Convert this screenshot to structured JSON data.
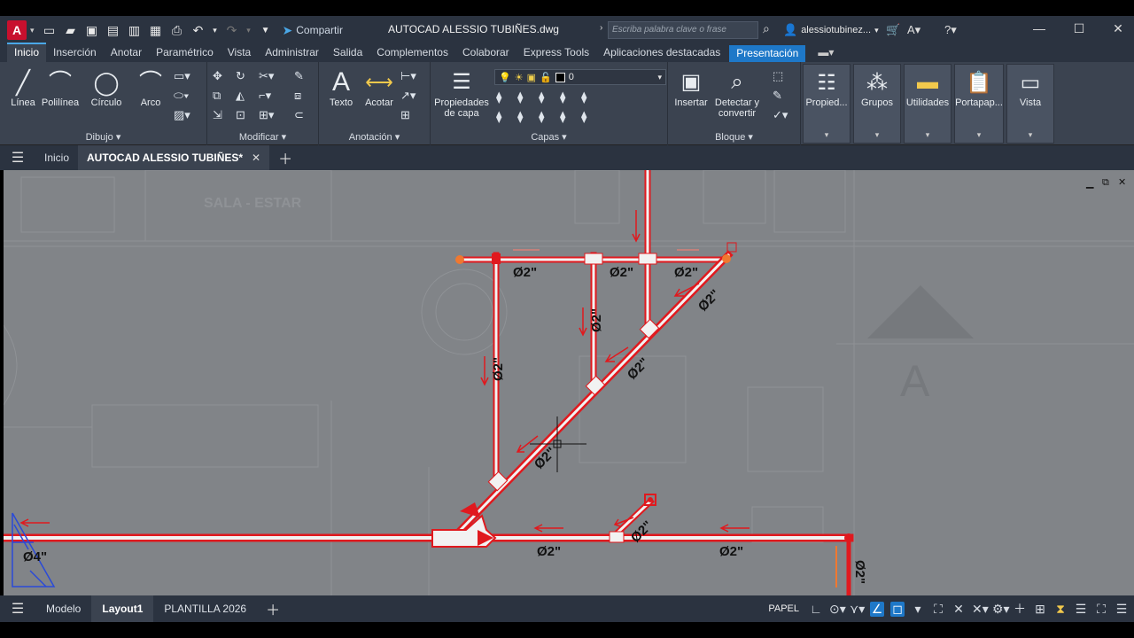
{
  "app": {
    "logo_letter": "A",
    "document_title": "AUTOCAD ALESSIO TUBIÑES.dwg",
    "share_label": "Compartir",
    "search_placeholder": "Escriba palabra clave o frase",
    "user_name": "alessiotubinez..."
  },
  "ribbon_tabs": [
    {
      "label": "Inicio",
      "active": true
    },
    {
      "label": "Inserción"
    },
    {
      "label": "Anotar"
    },
    {
      "label": "Paramétrico"
    },
    {
      "label": "Vista"
    },
    {
      "label": "Administrar"
    },
    {
      "label": "Salida"
    },
    {
      "label": "Complementos"
    },
    {
      "label": "Colaborar"
    },
    {
      "label": "Express Tools"
    },
    {
      "label": "Aplicaciones destacadas"
    },
    {
      "label": "Presentación"
    }
  ],
  "ribbon": {
    "draw": {
      "title": "Dibujo",
      "line": "Línea",
      "polyline": "Polilínea",
      "circle": "Círculo",
      "arc": "Arco"
    },
    "modify": {
      "title": "Modificar"
    },
    "annotation": {
      "title": "Anotación",
      "text": "Texto",
      "dimension": "Acotar"
    },
    "layers": {
      "title": "Capas",
      "layer_props_1": "Propiedades",
      "layer_props_2": "de capa",
      "current_layer": "0"
    },
    "block": {
      "title": "Bloque",
      "insert": "Insertar",
      "detect_1": "Detectar y",
      "detect_2": "convertir"
    },
    "extra": {
      "properties": "Propied...",
      "groups": "Grupos",
      "utilities": "Utilidades",
      "clipboard": "Portapap...",
      "view": "Vista"
    }
  },
  "file_tabs": {
    "home": "Inicio",
    "active_file": "AUTOCAD ALESSIO TUBIÑES*"
  },
  "drawing": {
    "room_label": "SALA - ESTAR",
    "section_marker": "A",
    "pipe_labels": [
      "Ø2\"",
      "Ø2\"",
      "Ø2\"",
      "Ø2\"",
      "Ø2\"",
      "Ø2\"",
      "Ø2\"",
      "Ø2\"",
      "Ø2\"",
      "Ø2\"",
      "Ø2\"",
      "Ø2\"",
      "Ø4\""
    ]
  },
  "status": {
    "model_tab": "Modelo",
    "layout1_tab": "Layout1",
    "layout2_tab": "PLANTILLA 2026",
    "space": "PAPEL"
  },
  "colors": {
    "pipe": "#e0191e",
    "pipe_inner": "#ffffff",
    "accent": "#1e78c8",
    "canvas": "#818488",
    "orange_fitting": "#f07830"
  }
}
